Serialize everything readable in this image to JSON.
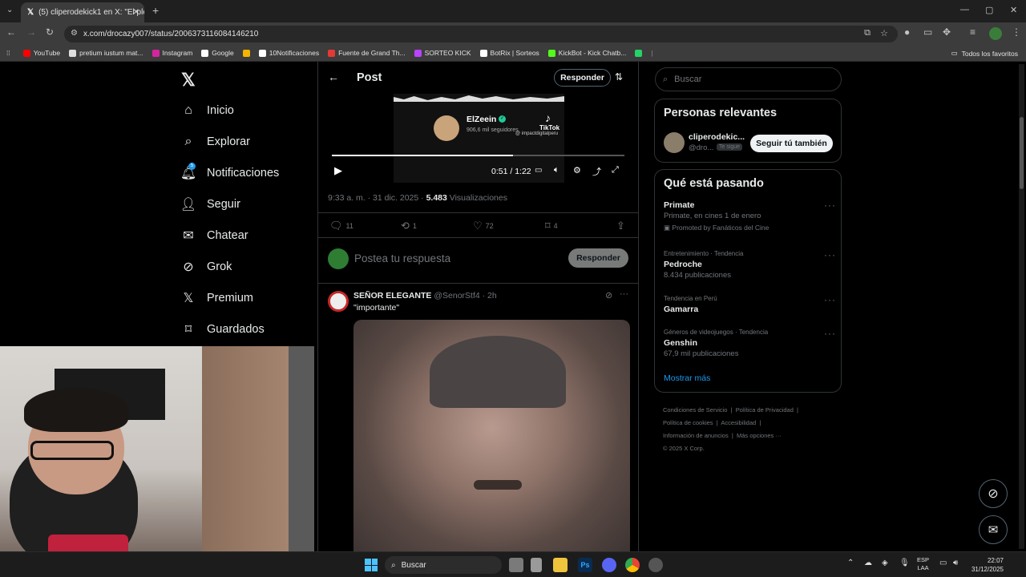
{
  "browser": {
    "tab_title": "(5) cliperodekick1 en X: \"El plen",
    "tab_close": "✕",
    "new_tab": "+",
    "url": "x.com/drocazy007/status/2006373116084146210",
    "bookmarks": [
      {
        "label": "YouTube",
        "color": "#ff0000"
      },
      {
        "label": "pretium iustum mat...",
        "color": "#dddddd"
      },
      {
        "label": "Instagram",
        "color": "#d6249f"
      },
      {
        "label": "Google",
        "color": "#ffffff"
      },
      {
        "label": "",
        "color": "#f4b400"
      },
      {
        "label": "10Notificaciones",
        "color": "#ffffff"
      },
      {
        "label": "Fuente de Grand Th...",
        "color": "#e53935"
      },
      {
        "label": "SORTEO KICK",
        "color": "#b844ff"
      },
      {
        "label": "BotRix | Sorteos",
        "color": "#ffffff"
      },
      {
        "label": "KickBot - Kick Chatb...",
        "color": "#53fc18"
      },
      {
        "label": "",
        "color": "#25d366"
      }
    ],
    "all_bookmarks": "Todos los favoritos"
  },
  "nav": {
    "items": [
      {
        "label": "Inicio",
        "icon": "home-icon"
      },
      {
        "label": "Explorar",
        "icon": "search-icon"
      },
      {
        "label": "Notificaciones",
        "icon": "bell-icon",
        "badge": "5"
      },
      {
        "label": "Seguir",
        "icon": "follow-icon"
      },
      {
        "label": "Chatear",
        "icon": "mail-icon"
      },
      {
        "label": "Grok",
        "icon": "grok-icon"
      },
      {
        "label": "Premium",
        "icon": "x-icon"
      },
      {
        "label": "Guardados",
        "icon": "bookmark-icon"
      }
    ]
  },
  "post": {
    "header_title": "Post",
    "reply_button": "Responder",
    "video": {
      "channel": "ElZeein",
      "followers": "906,6 mil seguidores",
      "tiktok": "TikTok",
      "watermark": "@ impactdigitalperu",
      "time": "0:51 / 1:22",
      "progress": 0.62
    },
    "meta_time": "9:33 a. m. · 31 dic. 2025 · ",
    "views_count": "5.483",
    "views_label": " Visualizaciones",
    "stats": {
      "replies": "11",
      "reposts": "1",
      "likes": "72",
      "bookmarks": "4"
    },
    "compose_placeholder": "Postea tu respuesta",
    "compose_button": "Responder"
  },
  "reply": {
    "name": "SEÑOR ELEGANTE",
    "handle": "@SenorStf4",
    "time": "· 2h",
    "text": "\"importante\""
  },
  "sidebar": {
    "search_placeholder": "Buscar",
    "relevant_title": "Personas relevantes",
    "person_name": "cliperodekic...",
    "person_handle": "@dro...",
    "follows_you": "Te sigue",
    "follow_button": "Seguir tú también",
    "trends_title": "Qué está pasando",
    "trends": [
      {
        "context": "",
        "title": "Primate",
        "subtitle": "Primate, en cines 1 de enero",
        "promoted": "Promoted by Fanáticos del Cine"
      },
      {
        "context": "Entretenimiento · Tendencia",
        "title": "Pedroche",
        "subtitle": "8.434 publicaciones",
        "promoted": ""
      },
      {
        "context": "Tendencia en Perú",
        "title": "Gamarra",
        "subtitle": "",
        "promoted": ""
      },
      {
        "context": "Géneros de videojuegos · Tendencia",
        "title": "Genshin",
        "subtitle": "67,9 mil publicaciones",
        "promoted": ""
      }
    ],
    "show_more": "Mostrar más",
    "footer": {
      "line1a": "Condiciones de Servicio",
      "line1b": "Política de Privacidad",
      "line2a": "Política de cookies",
      "line2b": "Accesibilidad",
      "line3a": "Información de anuncios",
      "line3b": "Más opciones ···",
      "copyright": "© 2025 X Corp."
    }
  },
  "taskbar": {
    "search": "Buscar",
    "lang1": "ESP",
    "lang2": "LAA",
    "time": "22:07",
    "date": "31/12/2025"
  }
}
